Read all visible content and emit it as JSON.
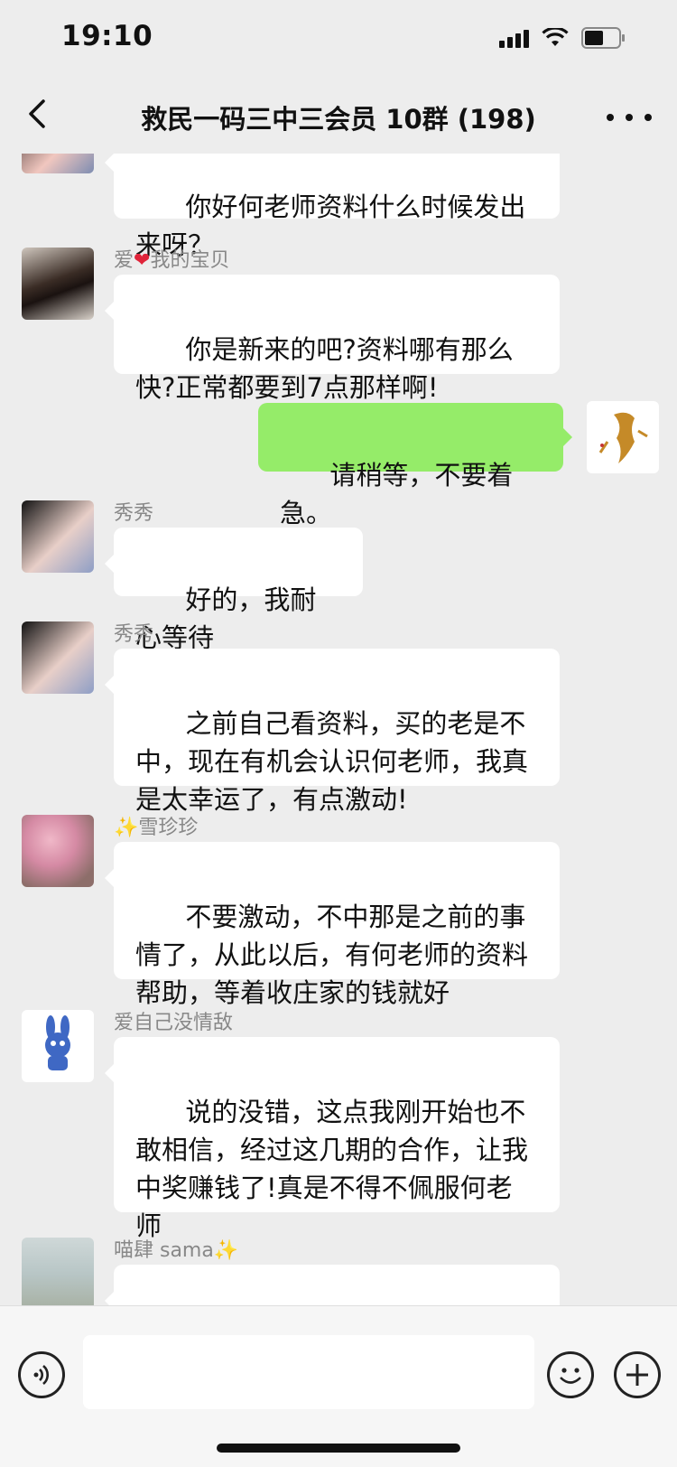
{
  "status": {
    "time": "19:10"
  },
  "header": {
    "title": "救民一码三中三会员 10群 (198)"
  },
  "messages": [
    {
      "sender": "",
      "text": "你好何老师资料什么时候发出来呀？"
    },
    {
      "sender_prefix": "爱",
      "sender_suffix": "我的宝贝",
      "text": "你是新来的吧?资料哪有那么快?正常都要到7点那样啊!"
    },
    {
      "sender": "",
      "text": "请稍等，不要着急。"
    },
    {
      "sender": "秀秀",
      "text": "好的，我耐心等待"
    },
    {
      "sender": "秀秀",
      "text": "之前自己看资料，买的老是不中，现在有机会认识何老师，我真是太幸运了，有点激动!"
    },
    {
      "sender_prefix": "✨",
      "sender_suffix": "雪珍珍",
      "text": "不要激动，不中那是之前的事情了，从此以后，有何老师的资料帮助，等着收庄家的钱就好"
    },
    {
      "sender": "爱自己没情敌",
      "text": "说的没错，这点我刚开始也不敢相信，经过这几期的合作，让我中奖赚钱了!真是不得不佩服何老师"
    },
    {
      "sender_prefix": "喵肆 sama",
      "sender_suffix": "✨",
      "text": ""
    }
  ],
  "input": {
    "placeholder": ""
  },
  "icons": {
    "back": "chevron-left-icon",
    "more": "more-dots-icon",
    "voice": "voice-icon",
    "emoji": "emoji-icon",
    "plus": "plus-icon",
    "heart": "red-heart-icon"
  },
  "colors": {
    "background": "#ededed",
    "bubble_incoming": "#ffffff",
    "bubble_outgoing": "#95ec69",
    "heart": "#e0243a"
  }
}
